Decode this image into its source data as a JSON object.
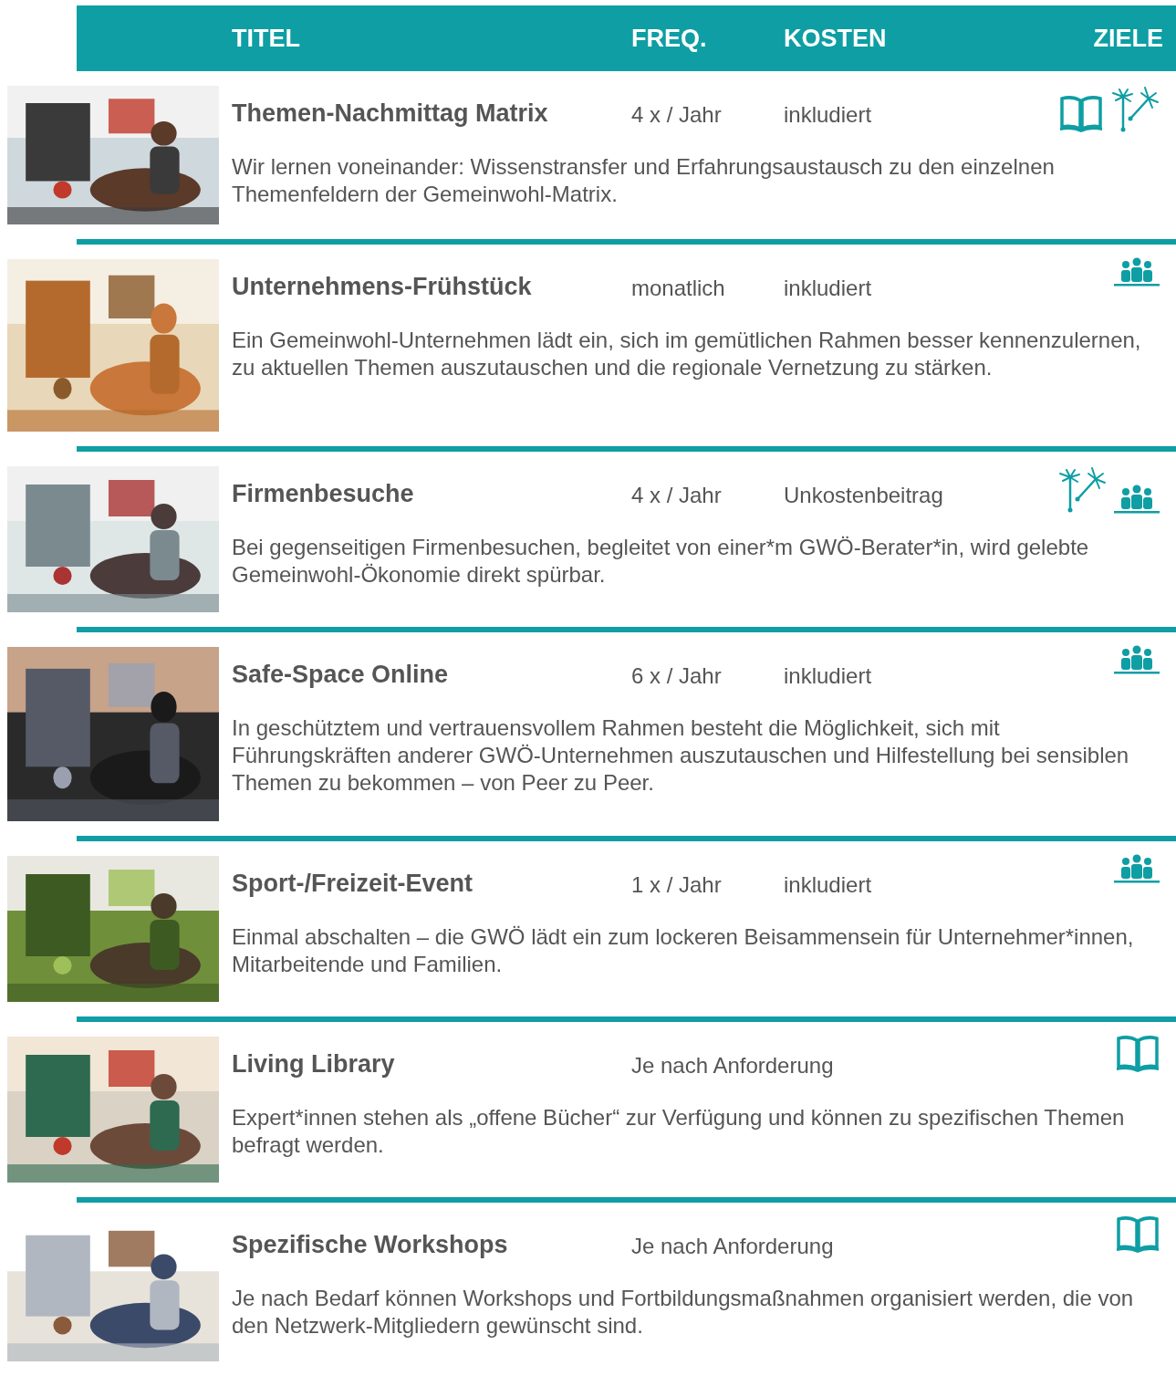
{
  "columns": [
    "TITEL",
    "FREQ.",
    "KOSTEN",
    "ZIELE"
  ],
  "rows": [
    {
      "title": "Themen-Nachmittag Matrix",
      "frequency": "4 x / Jahr",
      "cost": "inkludiert",
      "goals": [
        {
          "kind": "book"
        },
        {
          "kind": "seeds"
        }
      ],
      "description": "Wir lernen voneinander: Wissenstransfer und Erfahrungsaustausch zu den einzelnen Themenfeldern der Gemeinwohl-Matrix.",
      "image": {
        "kind": "picture"
      }
    },
    {
      "title": "Unternehmens-Frühstück",
      "frequency": "monatlich",
      "cost": "inkludiert",
      "goals": [
        {
          "kind": "people"
        }
      ],
      "description": "Ein Gemeinwohl-Unternehmen lädt ein, sich im gemütlichen Rahmen besser kennenzulernen, zu aktuellen Themen auszutauschen und die regionale Vernetzung zu stärken.",
      "image": {
        "kind": "picture"
      }
    },
    {
      "title": "Firmenbesuche",
      "frequency": "4 x / Jahr",
      "cost": "Unkostenbeitrag",
      "goals": [
        {
          "kind": "seeds"
        },
        {
          "kind": "people"
        }
      ],
      "description": "Bei gegenseitigen Firmenbesuchen, begleitet von einer*m GWÖ-Berater*in, wird gelebte Gemeinwohl-Ökonomie direkt spürbar.",
      "image": {
        "kind": "picture"
      }
    },
    {
      "title": "Safe-Space Online",
      "frequency": "6 x / Jahr",
      "cost": "inkludiert",
      "goals": [
        {
          "kind": "people"
        }
      ],
      "description": "In geschütztem und vertrauensvollem Rahmen besteht die Möglichkeit, sich mit Führungskräften anderer GWÖ-Unternehmen auszutauschen und Hilfestellung bei sensiblen Themen zu bekommen – von Peer zu Peer.",
      "image": {
        "kind": "picture"
      }
    },
    {
      "title": "Sport-/Freizeit-Event",
      "frequency": "1 x / Jahr",
      "cost": "inkludiert",
      "goals": [
        {
          "kind": "people"
        }
      ],
      "description": "Einmal abschalten – die GWÖ lädt ein zum lockeren Beisammensein für Unternehmer*innen, Mitarbeitende und Familien.",
      "image": {
        "kind": "picture"
      }
    },
    {
      "title": "Living Library",
      "frequency": "Je nach Anforderung",
      "goals": [
        {
          "kind": "book"
        }
      ],
      "description": "Expert*innen stehen als „offene Bücher“ zur Verfügung und können zu spezifischen Themen befragt werden.",
      "image": {
        "kind": "picture"
      }
    },
    {
      "title": "Spezifische Workshops",
      "frequency": "Je nach Anforderung",
      "goals": [
        {
          "kind": "book"
        }
      ],
      "description": "Je nach Bedarf können Workshops und Fortbildungsmaßnahmen organisiert werden, die von den Netzwerk-Mitgliedern gewünscht sind.",
      "image": {
        "kind": "picture"
      }
    }
  ]
}
